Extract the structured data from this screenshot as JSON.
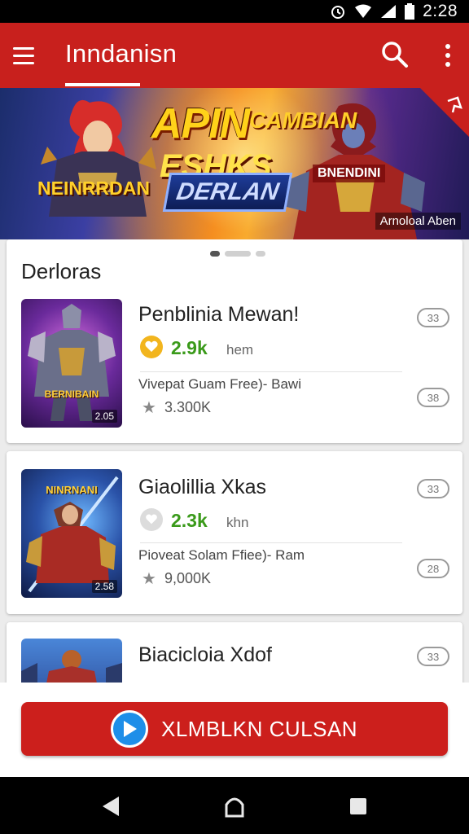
{
  "status_bar": {
    "time": "2:28",
    "icons": [
      "alarm-icon",
      "wifi-icon",
      "signal-icon",
      "battery-icon"
    ]
  },
  "app_bar": {
    "title": "Inndanisn",
    "icons": [
      "menu-icon",
      "search-icon",
      "more-vert-icon"
    ]
  },
  "banner": {
    "headline": "APIN",
    "headline_2": "CAMBIAN",
    "sub_headline": "ESHKS",
    "logo_text": "DERLAN",
    "left_label": "NEINRRDAN",
    "right_label": "BNENDINI",
    "caption": "Arnoloal Aben"
  },
  "carousel": {
    "dot_count": 3,
    "active_index": 0
  },
  "section": {
    "title": "Derloras"
  },
  "items": [
    {
      "name": "Penblinia Mewan!",
      "rating": "2.9k",
      "rating_unit": "hem",
      "description": "Vivepat Guam Free)- Bawi",
      "downloads": "3.300K",
      "thumb_badge": "2.05",
      "thumb_label": "BERNIBAIN",
      "pill_top": "33",
      "pill_bottom": "38"
    },
    {
      "name": "Giaolillia Xkas",
      "rating": "2.3k",
      "rating_unit": "khn",
      "description": "Pioveat Solam Ffiee)- Ram",
      "downloads": "9,000K",
      "thumb_badge": "2.58",
      "thumb_label": "NINRNANI",
      "pill_top": "33",
      "pill_bottom": "28"
    },
    {
      "name": "Biacicloia Xdof",
      "pill_top": "33"
    }
  ],
  "action": {
    "label": "XLMBLKN CULSAN"
  },
  "colors": {
    "app_bar": "#c8201d",
    "rating_green": "#3a9a1a",
    "play_blue": "#1e8ee8"
  }
}
